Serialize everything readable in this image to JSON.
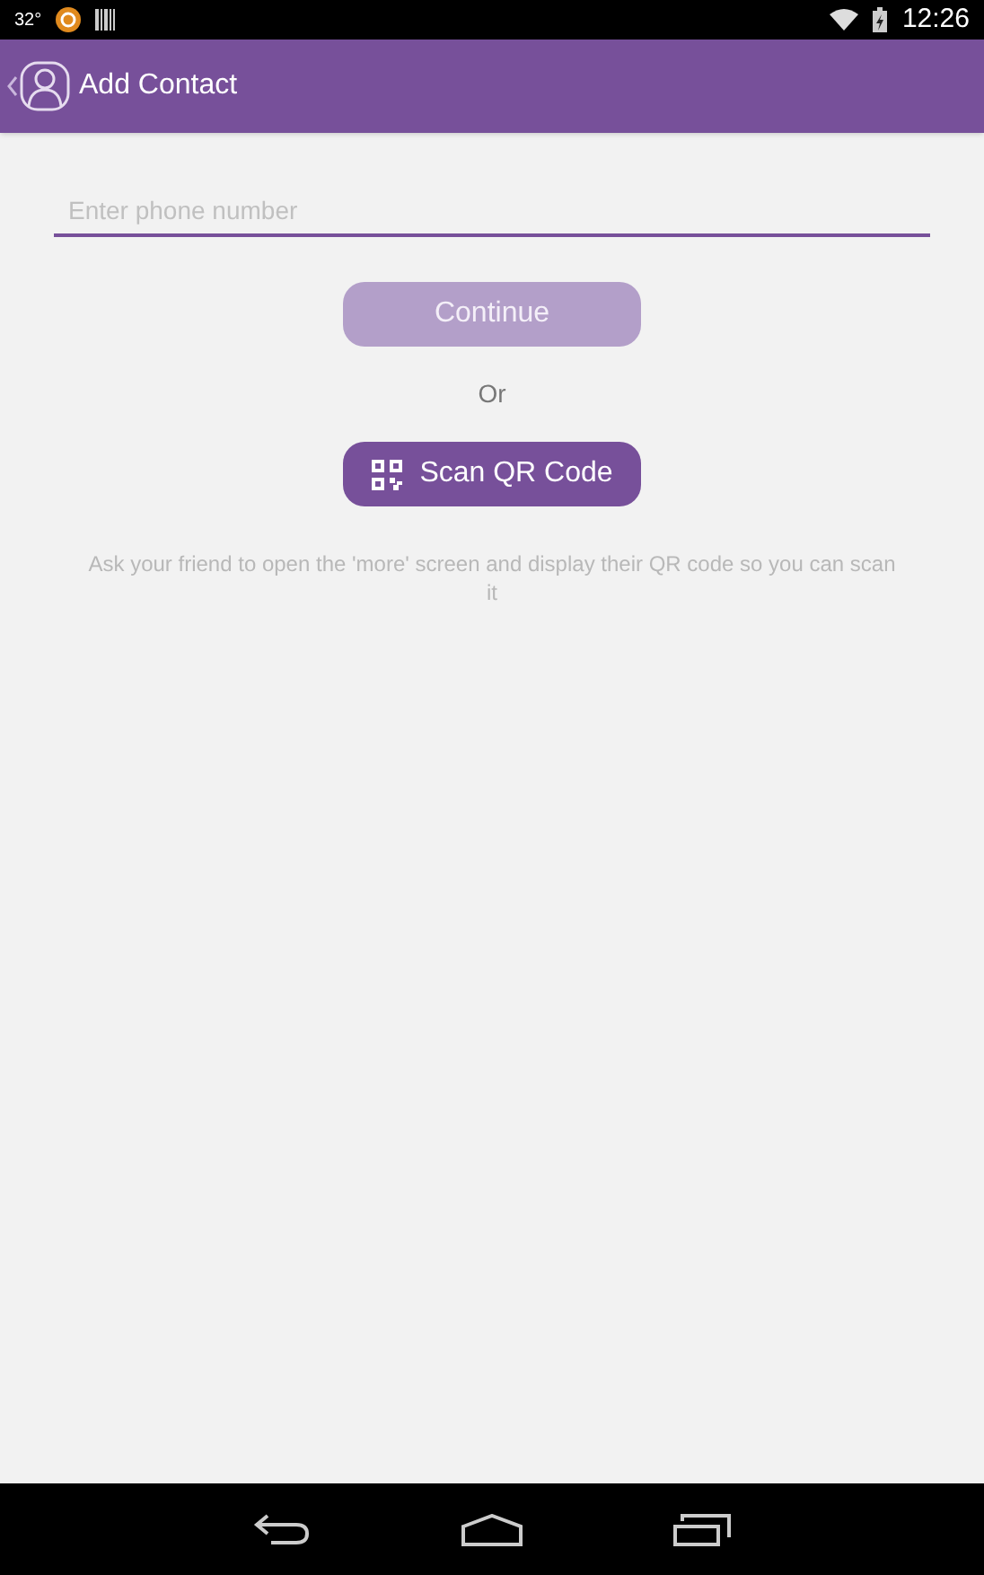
{
  "status_bar": {
    "temperature": "32°",
    "time": "12:26"
  },
  "app_bar": {
    "title": "Add Contact"
  },
  "phone_field": {
    "placeholder": "Enter phone number"
  },
  "continue_button": {
    "label": "Continue",
    "disabled": true
  },
  "separator": "Or",
  "scan_button": {
    "label": "Scan QR Code"
  },
  "hint": "Ask your friend to open the 'more' screen and display their QR code so you can scan it"
}
